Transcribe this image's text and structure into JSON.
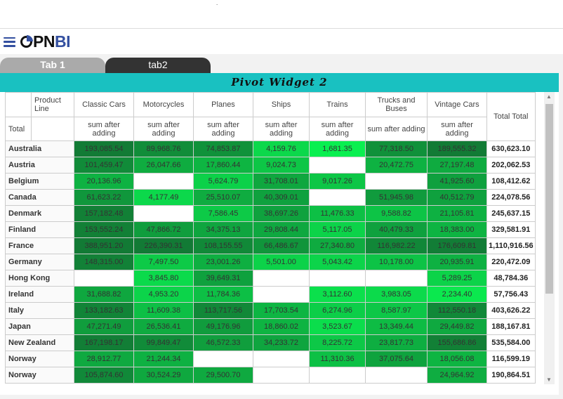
{
  "app": {
    "logo": "OPNBI",
    "logo_part1": "PN",
    "logo_part2": "BI"
  },
  "tabs": [
    {
      "label": "Tab 1",
      "active": false
    },
    {
      "label": "tab2",
      "active": true
    }
  ],
  "widget": {
    "title": "Pivot Widget 2",
    "corner": {
      "column_field": "Product Line",
      "row_field": "Total"
    },
    "measure": "sum after adding",
    "columns": [
      "Classic Cars",
      "Motorcycles",
      "Planes",
      "Ships",
      "Trains",
      "Trucks and Buses",
      "Vintage Cars"
    ],
    "total_header": "Total Total",
    "rows": [
      {
        "label": "Australia",
        "values": [
          "193,085.54",
          "89,968.76",
          "74,853.87",
          "4,159.76",
          "1,681.35",
          "77,318.50",
          "189,555.32"
        ],
        "total": "630,623.10"
      },
      {
        "label": "Austria",
        "values": [
          "101,459.47",
          "26,047.66",
          "17,860.44",
          "9,024.73",
          "",
          "20,472.75",
          "27,197.48"
        ],
        "total": "202,062.53"
      },
      {
        "label": "Belgium",
        "values": [
          "20,136.96",
          "",
          "5,624.79",
          "31,708.01",
          "9,017.26",
          "",
          "41,925.60"
        ],
        "total": "108,412.62"
      },
      {
        "label": "Canada",
        "values": [
          "61,623.22",
          "4,177.49",
          "25,510.07",
          "40,309.01",
          "",
          "51,945.98",
          "40,512.79"
        ],
        "total": "224,078.56"
      },
      {
        "label": "Denmark",
        "values": [
          "157,182.48",
          "",
          "7,586.45",
          "38,697.26",
          "11,476.33",
          "9,588.82",
          "21,105.81"
        ],
        "total": "245,637.15"
      },
      {
        "label": "Finland",
        "values": [
          "153,552.24",
          "47,866.72",
          "34,375.13",
          "29,808.44",
          "5,117.05",
          "40,479.33",
          "18,383.00"
        ],
        "total": "329,581.91"
      },
      {
        "label": "France",
        "values": [
          "388,951.20",
          "226,390.31",
          "108,155.55",
          "66,486.67",
          "27,340.80",
          "116,982.22",
          "176,609.81"
        ],
        "total": "1,110,916.56"
      },
      {
        "label": "Germany",
        "values": [
          "148,315.00",
          "7,497.50",
          "23,001.26",
          "5,501.00",
          "5,043.42",
          "10,178.00",
          "20,935.91"
        ],
        "total": "220,472.09"
      },
      {
        "label": "Hong Kong",
        "values": [
          "",
          "3,845.80",
          "39,649.31",
          "",
          "",
          "",
          "5,289.25"
        ],
        "total": "48,784.36"
      },
      {
        "label": "Ireland",
        "values": [
          "31,688.82",
          "4,953.20",
          "11,784.36",
          "",
          "3,112.60",
          "3,983.05",
          "2,234.40"
        ],
        "total": "57,756.43"
      },
      {
        "label": "Italy",
        "values": [
          "133,182.63",
          "11,609.38",
          "113,717.56",
          "17,703.54",
          "6,274.96",
          "8,587.97",
          "112,550.18"
        ],
        "total": "403,626.22"
      },
      {
        "label": "Japan",
        "values": [
          "47,271.49",
          "26,536.41",
          "49,176.96",
          "18,860.02",
          "3,523.67",
          "13,349.44",
          "29,449.82"
        ],
        "total": "188,167.81"
      },
      {
        "label": "New Zealand",
        "values": [
          "167,198.17",
          "99,849.47",
          "46,572.33",
          "34,233.72",
          "8,225.72",
          "23,817.73",
          "155,686.86"
        ],
        "total": "535,584.00"
      },
      {
        "label": "Norway",
        "values": [
          "28,912.77",
          "21,244.34",
          "",
          "",
          "11,310.36",
          "37,075.64",
          "18,056.08"
        ],
        "total": "116,599.19"
      },
      {
        "label": "Norway",
        "values": [
          "105,874.60",
          "30,524.29",
          "29,500.70",
          "",
          "",
          "",
          "24,964.92"
        ],
        "total": "190,864.51"
      }
    ]
  },
  "colors": {
    "accent": "#19c1c1",
    "heat_low": "#0af050",
    "heat_high": "#127a35",
    "brand": "#3450a0"
  }
}
